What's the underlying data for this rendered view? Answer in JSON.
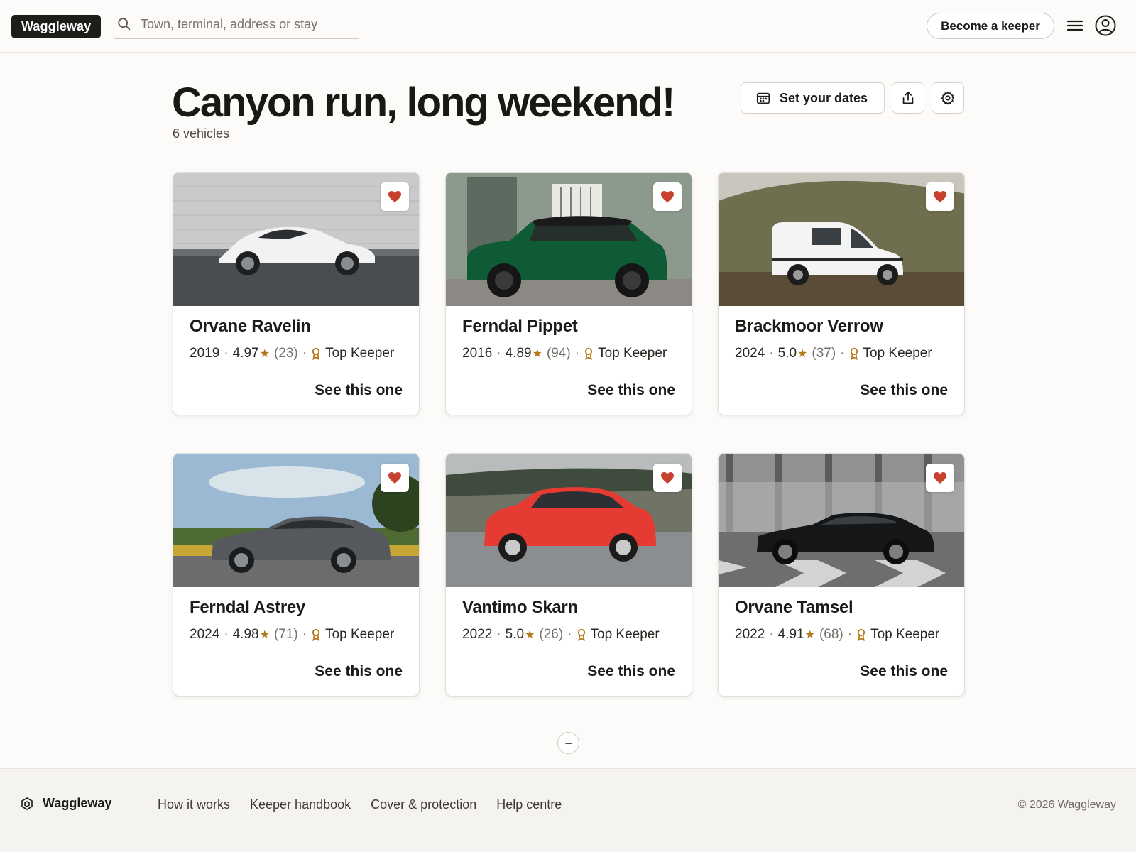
{
  "header": {
    "logo": "Waggleway",
    "search_placeholder": "Town, terminal, address or stay",
    "keeper_button": "Become a keeper"
  },
  "page": {
    "title": "Canyon run, long weekend!",
    "subtitle": "6 vehicles",
    "dates_button": "Set your dates"
  },
  "cards": [
    {
      "name": "Orvane Ravelin",
      "year": "2019",
      "rating": "4.97",
      "reviews": "(23)",
      "badge": "Top Keeper",
      "cta": "See this one"
    },
    {
      "name": "Ferndal Pippet",
      "year": "2016",
      "rating": "4.89",
      "reviews": "(94)",
      "badge": "Top Keeper",
      "cta": "See this one"
    },
    {
      "name": "Brackmoor Verrow",
      "year": "2024",
      "rating": "5.0",
      "reviews": "(37)",
      "badge": "Top Keeper",
      "cta": "See this one"
    },
    {
      "name": "Ferndal Astrey",
      "year": "2024",
      "rating": "4.98",
      "reviews": "(71)",
      "badge": "Top Keeper",
      "cta": "See this one"
    },
    {
      "name": "Vantimo Skarn",
      "year": "2022",
      "rating": "5.0",
      "reviews": "(26)",
      "badge": "Top Keeper",
      "cta": "See this one"
    },
    {
      "name": "Orvane Tamsel",
      "year": "2022",
      "rating": "4.91",
      "reviews": "(68)",
      "badge": "Top Keeper",
      "cta": "See this one"
    }
  ],
  "footer": {
    "brand": "Waggleway",
    "links": [
      "How it works",
      "Keeper handbook",
      "Cover & protection",
      "Help centre"
    ],
    "copyright": "© 2026 Waggleway"
  },
  "colors": {
    "accent_heart": "#c8412e",
    "star": "#b5781b",
    "logo_bg": "#1f1d1a"
  }
}
